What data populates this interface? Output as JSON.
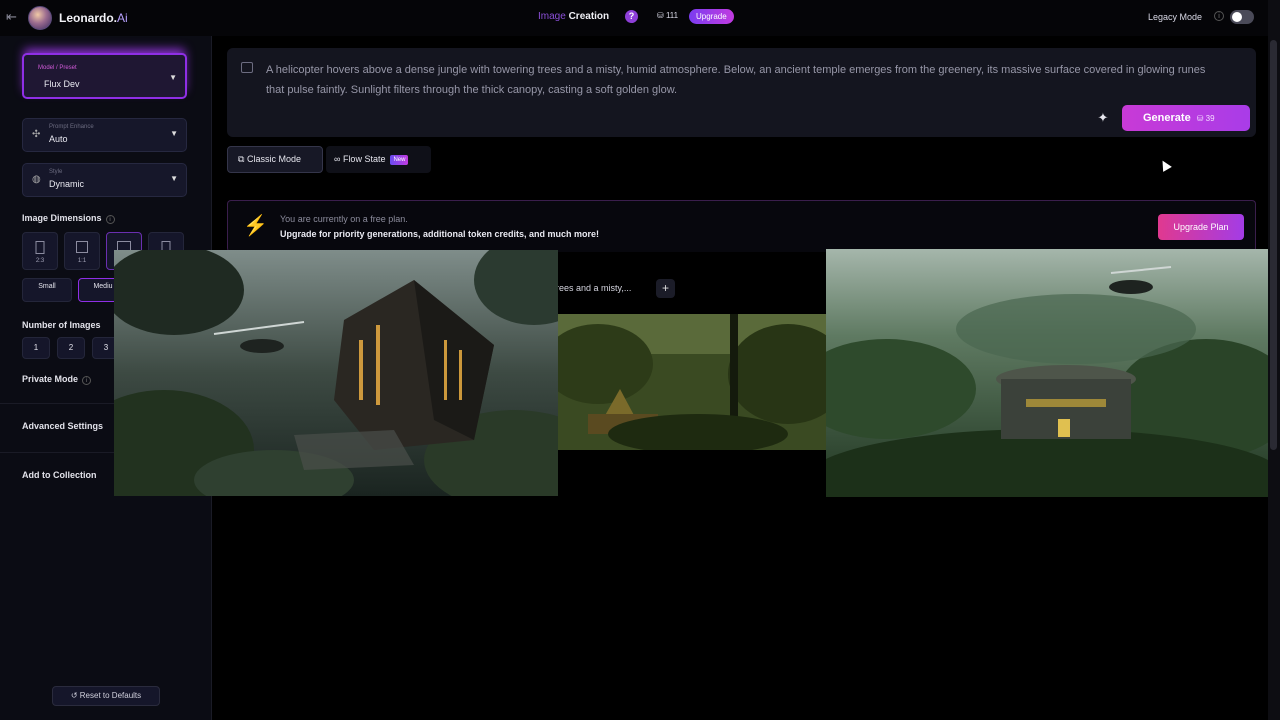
{
  "topbar": {
    "back_icon": "back-arrow-icon",
    "brand": "Leonardo.",
    "brand_suffix": "Ai",
    "section": "Image",
    "page": "Creation",
    "tokens": "111",
    "upgrade_label": "Upgrade",
    "legacy_label": "Legacy Mode",
    "legacy_enabled": false
  },
  "sidebar": {
    "model": {
      "label": "Model / Preset",
      "value": "Flux Dev"
    },
    "enhance": {
      "label": "Prompt Enhance",
      "value": "Auto"
    },
    "style": {
      "label": "Style",
      "value": "Dynamic"
    },
    "dimensions_title": "Image Dimensions",
    "ratios": [
      "2:3",
      "1:1"
    ],
    "sizes": [
      {
        "name": "Small",
        "sub": ""
      },
      {
        "name": "Mediu",
        "sub": ""
      }
    ],
    "num_images_title": "Number of Images",
    "num_images": [
      "1",
      "2",
      "3"
    ],
    "private_mode": "Private Mode",
    "advanced": "Advanced Settings",
    "collection": "Add to Collection",
    "reset": "Reset to Defaults"
  },
  "prompt": {
    "text": "A helicopter hovers above a dense jungle with towering trees and a misty, humid atmosphere. Below, an ancient temple emerges from the greenery, its massive surface covered in glowing runes that pulse faintly. Sunlight filters through the thick canopy, casting a soft golden glow.",
    "generate_label": "Generate",
    "generate_cost": "39"
  },
  "modes": {
    "classic": "Classic Mode",
    "flow": "Flow State",
    "flow_badge": "New"
  },
  "banner": {
    "line1": "You are currently on a free plan.",
    "line2": "Upgrade for priority generations, additional token credits, and much more!",
    "button": "Upgrade Plan"
  },
  "generation": {
    "prompt_snippet": "rees and a misty,...",
    "add_label": "+"
  },
  "colors": {
    "accent": "#a93ce8",
    "brand_pink": "#c83ad6",
    "background": "#000000",
    "panel": "#14151f"
  }
}
